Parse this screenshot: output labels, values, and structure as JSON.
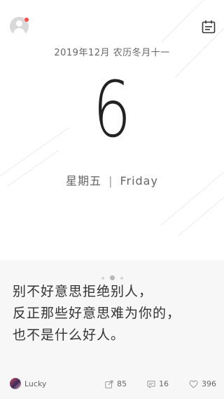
{
  "header": {
    "date_line": "2019年12月 农历冬月十一",
    "day_number": "6",
    "weekday_cn": "星期五",
    "separator": "|",
    "weekday_en": "Friday"
  },
  "icons": {
    "avatar": "user-avatar-icon",
    "notification": "notification-dot",
    "calendar": "calendar-icon",
    "share": "share-icon",
    "comment": "comment-icon",
    "like": "heart-icon"
  },
  "pager": {
    "count": 3,
    "active": 1
  },
  "quote": {
    "lines": [
      "别不好意思拒绝别人，",
      "反正那些好意思难为你的，",
      "也不是什么好人。"
    ]
  },
  "footer": {
    "author": "Lucky",
    "shares": "85",
    "comments": "16",
    "likes": "396"
  },
  "colors": {
    "background_top": "#ffffff",
    "background_bottom": "#f7f7f7",
    "notification": "#ff4d4d",
    "text_primary": "#222222"
  }
}
